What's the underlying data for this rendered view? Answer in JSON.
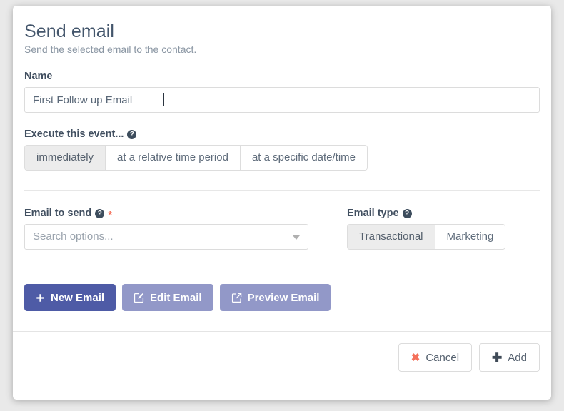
{
  "dialog": {
    "title": "Send email",
    "subtitle": "Send the selected email to the contact."
  },
  "name_field": {
    "label": "Name",
    "value": "First Follow up Email",
    "placeholder": ""
  },
  "execute_event": {
    "label": "Execute this event...",
    "help_icon": "question-circle-icon",
    "options": [
      {
        "label": "immediately",
        "selected": true
      },
      {
        "label": "at a relative time period",
        "selected": false
      },
      {
        "label": "at a specific date/time",
        "selected": false
      }
    ]
  },
  "email_to_send": {
    "label": "Email to send",
    "help_icon": "question-circle-icon",
    "required_marker": "*",
    "placeholder": "Search options...",
    "value": "",
    "caret_icon": "chevron-down-icon"
  },
  "email_type": {
    "label": "Email type",
    "help_icon": "question-circle-icon",
    "options": [
      {
        "label": "Transactional",
        "selected": true
      },
      {
        "label": "Marketing",
        "selected": false
      }
    ]
  },
  "email_actions": [
    {
      "label": "New Email",
      "icon": "plus-icon",
      "style": "primary"
    },
    {
      "label": "Edit Email",
      "icon": "pencil-square-icon",
      "style": "muted"
    },
    {
      "label": "Preview Email",
      "icon": "external-link-icon",
      "style": "muted"
    }
  ],
  "footer": {
    "cancel_label": "Cancel",
    "cancel_icon": "times-icon",
    "add_label": "Add",
    "add_icon": "plus-icon"
  },
  "colors": {
    "primary": "#4e5ba6",
    "muted": "#9298c8",
    "danger": "#f4715b",
    "text": "#44566c",
    "subtext": "#8a96a3",
    "border": "#dcdcdc",
    "selected_segment": "#ececec",
    "page_background": "#e9e9e9"
  }
}
